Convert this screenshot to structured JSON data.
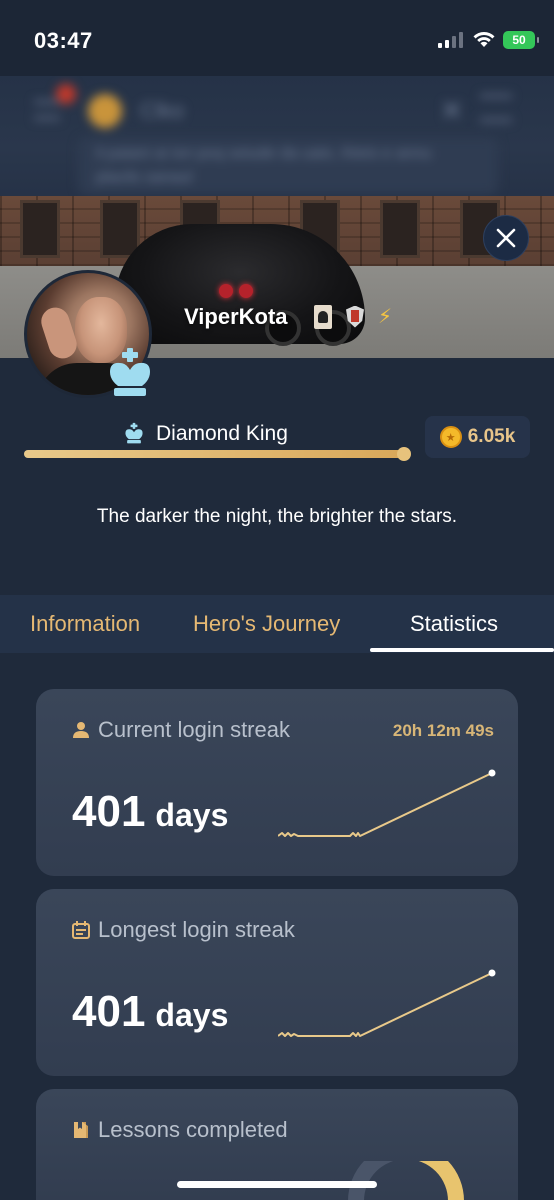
{
  "status_bar": {
    "time": "03:47",
    "battery": "50"
  },
  "background": {
    "title": "Clko",
    "text": "il paiani ai ion poq seiude da uaio, ihieis e annu placils sanaul"
  },
  "profile": {
    "username": "ViperKota",
    "rank": "Diamond King",
    "rank_progress": 0.99,
    "coins": "6.05k",
    "bio": "The darker the night, the brighter the stars.",
    "badges": [
      "spy-badge",
      "shield-badge",
      "lightning-badge"
    ]
  },
  "tabs": [
    {
      "label": "Information",
      "active": false
    },
    {
      "label": "Hero's Journey",
      "active": false
    },
    {
      "label": "Statistics",
      "active": true
    }
  ],
  "stats": {
    "current_streak": {
      "label": "Current login streak",
      "timer": "20h 12m 49s",
      "value": "401",
      "unit": "days"
    },
    "longest_streak": {
      "label": "Longest login streak",
      "value": "401",
      "unit": "days"
    },
    "lessons": {
      "label": "Lessons completed"
    }
  },
  "colors": {
    "accent_gold": "#e5b873",
    "background": "#1f2a3b",
    "card": "#36425a",
    "battery_green": "#34c759"
  }
}
